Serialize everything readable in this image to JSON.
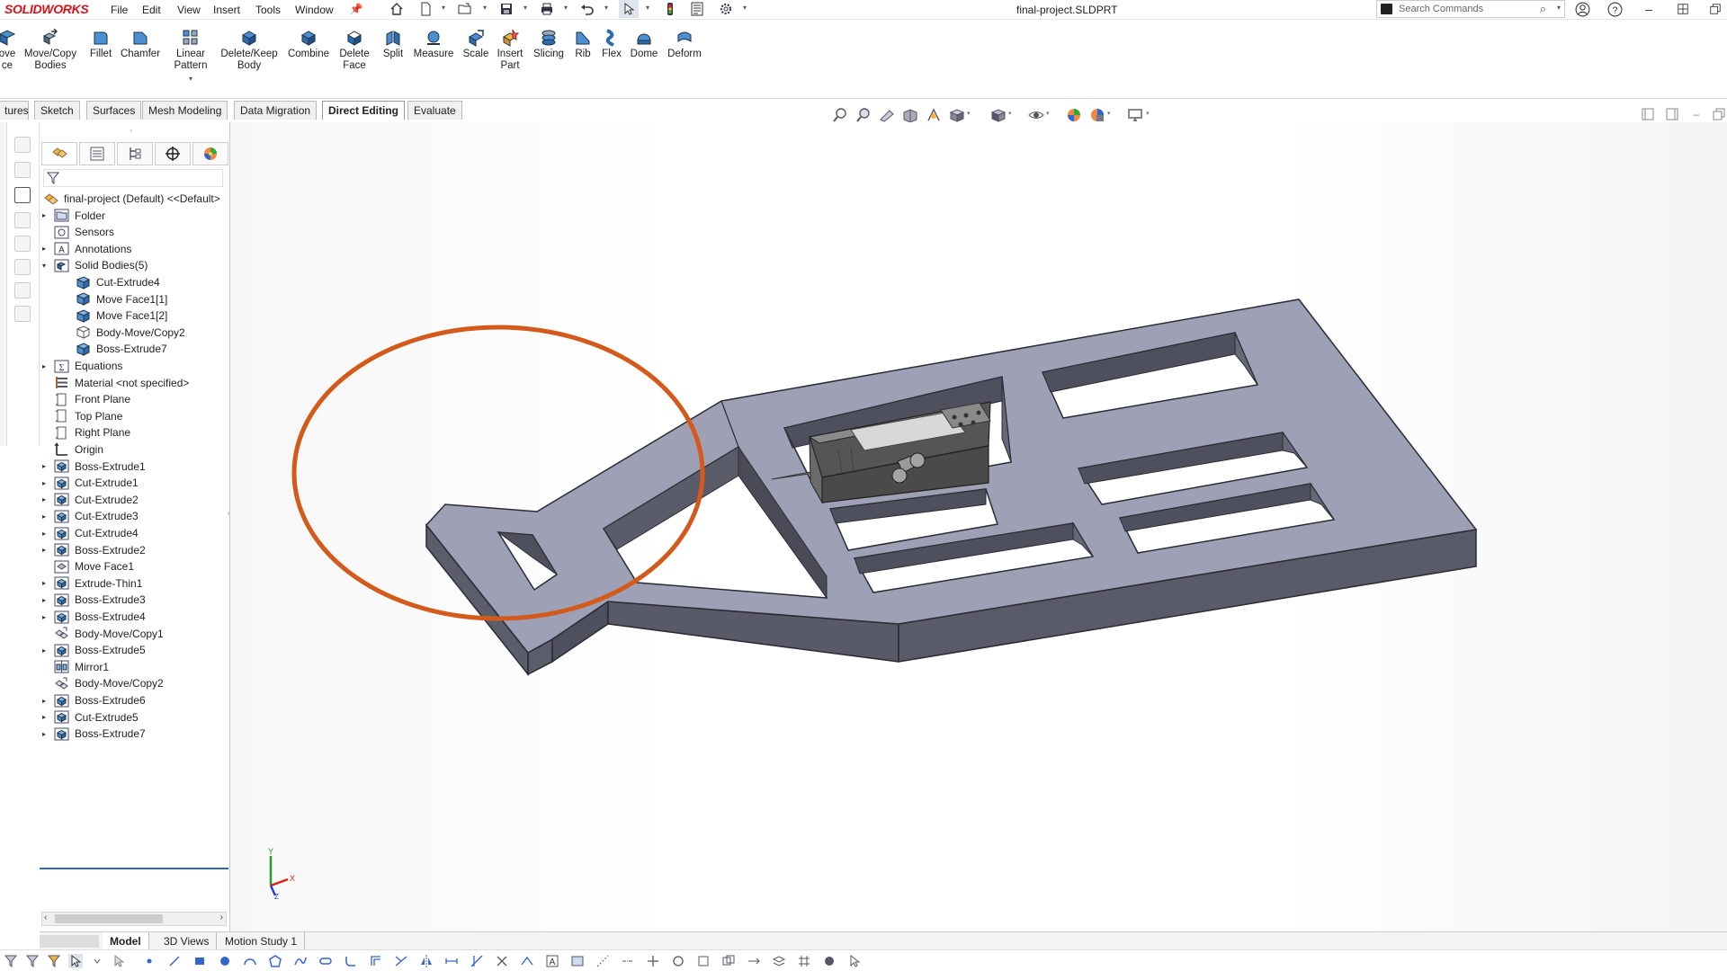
{
  "app": {
    "logo_prefix": "SOLID",
    "logo_suffix": "WORKS",
    "doc_title": "final-project.SLDPRT"
  },
  "menu": [
    "File",
    "Edit",
    "View",
    "Insert",
    "Tools",
    "Window"
  ],
  "search": {
    "placeholder": "Search Commands"
  },
  "toolbar": {
    "tools": [
      {
        "l1": "ove",
        "l2": "ce",
        "icon": "move-face-icon"
      },
      {
        "l1": "Move/Copy",
        "l2": "Bodies",
        "icon": "move-copy-bodies-icon"
      },
      {
        "l1": "Fillet",
        "l2": "",
        "icon": "fillet-icon"
      },
      {
        "l1": "Chamfer",
        "l2": "",
        "icon": "chamfer-icon"
      },
      {
        "l1": "Linear",
        "l2": "Pattern",
        "icon": "linear-pattern-icon"
      },
      {
        "l1": "Delete/Keep",
        "l2": "Body",
        "icon": "delete-keep-body-icon"
      },
      {
        "l1": "Combine",
        "l2": "",
        "icon": "combine-icon"
      },
      {
        "l1": "Delete",
        "l2": "Face",
        "icon": "delete-face-icon"
      },
      {
        "l1": "Split",
        "l2": "",
        "icon": "split-icon"
      },
      {
        "l1": "Measure",
        "l2": "",
        "icon": "measure-icon"
      },
      {
        "l1": "Scale",
        "l2": "",
        "icon": "scale-icon"
      },
      {
        "l1": "Insert",
        "l2": "Part",
        "icon": "insert-part-icon"
      },
      {
        "l1": "Slicing",
        "l2": "",
        "icon": "slicing-icon"
      },
      {
        "l1": "Rib",
        "l2": "",
        "icon": "rib-icon"
      },
      {
        "l1": "Flex",
        "l2": "",
        "icon": "flex-icon"
      },
      {
        "l1": "Dome",
        "l2": "",
        "icon": "dome-icon"
      },
      {
        "l1": "Deform",
        "l2": "",
        "icon": "deform-icon"
      }
    ]
  },
  "tabs": [
    "tures",
    "Sketch",
    "Surfaces",
    "Mesh Modeling",
    "Data Migration",
    "Direct Editing",
    "Evaluate"
  ],
  "active_tab": "Direct Editing",
  "tree": {
    "root": "final-project (Default) <<Default>",
    "nodes": [
      {
        "label": "Folder",
        "icon": "folder-icon",
        "exp": "▸",
        "indent": 0
      },
      {
        "label": "Sensors",
        "icon": "sensors-icon",
        "exp": "",
        "indent": 0
      },
      {
        "label": "Annotations",
        "icon": "annotations-icon",
        "exp": "▸",
        "indent": 0
      },
      {
        "label": "Solid Bodies(5)",
        "icon": "solid-bodies-icon",
        "exp": "▾",
        "indent": 0
      },
      {
        "label": "Cut-Extrude4",
        "icon": "body-icon",
        "exp": "",
        "indent": 1
      },
      {
        "label": "Move Face1[1]",
        "icon": "body-icon",
        "exp": "",
        "indent": 1
      },
      {
        "label": "Move Face1[2]",
        "icon": "body-icon",
        "exp": "",
        "indent": 1
      },
      {
        "label": "Body-Move/Copy2",
        "icon": "body-outline-icon",
        "exp": "",
        "indent": 1
      },
      {
        "label": "Boss-Extrude7",
        "icon": "body-icon",
        "exp": "",
        "indent": 1
      },
      {
        "label": "Equations",
        "icon": "equations-icon",
        "exp": "▸",
        "indent": 0
      },
      {
        "label": "Material <not specified>",
        "icon": "material-icon",
        "exp": "",
        "indent": 0
      },
      {
        "label": "Front Plane",
        "icon": "plane-icon",
        "exp": "",
        "indent": 0
      },
      {
        "label": "Top Plane",
        "icon": "plane-icon",
        "exp": "",
        "indent": 0
      },
      {
        "label": "Right Plane",
        "icon": "plane-icon",
        "exp": "",
        "indent": 0
      },
      {
        "label": "Origin",
        "icon": "origin-icon",
        "exp": "",
        "indent": 0
      },
      {
        "label": "Boss-Extrude1",
        "icon": "feature-icon",
        "exp": "▸",
        "indent": 0
      },
      {
        "label": "Cut-Extrude1",
        "icon": "feature-icon",
        "exp": "▸",
        "indent": 0
      },
      {
        "label": "Cut-Extrude2",
        "icon": "feature-icon",
        "exp": "▸",
        "indent": 0
      },
      {
        "label": "Cut-Extrude3",
        "icon": "feature-icon",
        "exp": "▸",
        "indent": 0
      },
      {
        "label": "Cut-Extrude4",
        "icon": "feature-icon",
        "exp": "▸",
        "indent": 0
      },
      {
        "label": "Boss-Extrude2",
        "icon": "feature-icon",
        "exp": "▸",
        "indent": 0
      },
      {
        "label": "Move Face1",
        "icon": "move-face-icon",
        "exp": "",
        "indent": 0
      },
      {
        "label": "Extrude-Thin1",
        "icon": "feature-icon",
        "exp": "▸",
        "indent": 0
      },
      {
        "label": "Boss-Extrude3",
        "icon": "feature-icon",
        "exp": "▸",
        "indent": 0
      },
      {
        "label": "Boss-Extrude4",
        "icon": "feature-icon",
        "exp": "▸",
        "indent": 0
      },
      {
        "label": "Body-Move/Copy1",
        "icon": "move-copy-icon",
        "exp": "",
        "indent": 0
      },
      {
        "label": "Boss-Extrude5",
        "icon": "feature-icon",
        "exp": "▸",
        "indent": 0
      },
      {
        "label": "Mirror1",
        "icon": "mirror-icon",
        "exp": "",
        "indent": 0
      },
      {
        "label": "Body-Move/Copy2",
        "icon": "move-copy-icon",
        "exp": "",
        "indent": 0
      },
      {
        "label": "Boss-Extrude6",
        "icon": "feature-icon",
        "exp": "▸",
        "indent": 0
      },
      {
        "label": "Cut-Extrude5",
        "icon": "feature-icon",
        "exp": "▸",
        "indent": 0
      },
      {
        "label": "Boss-Extrude7",
        "icon": "feature-icon",
        "exp": "▸",
        "indent": 0
      }
    ]
  },
  "bottom_tabs": [
    "Model",
    "3D Views",
    "Motion Study 1"
  ],
  "active_bottom_tab": "Model",
  "triad": {
    "y": "Y",
    "x": "X",
    "z": "Z"
  },
  "colors": {
    "accent": "#d6131a",
    "highlight_circle": "#d35a1a",
    "model_top": "#9ea0b6",
    "model_side": "#5c5d6b",
    "tree_rule": "#2d6bb3"
  }
}
